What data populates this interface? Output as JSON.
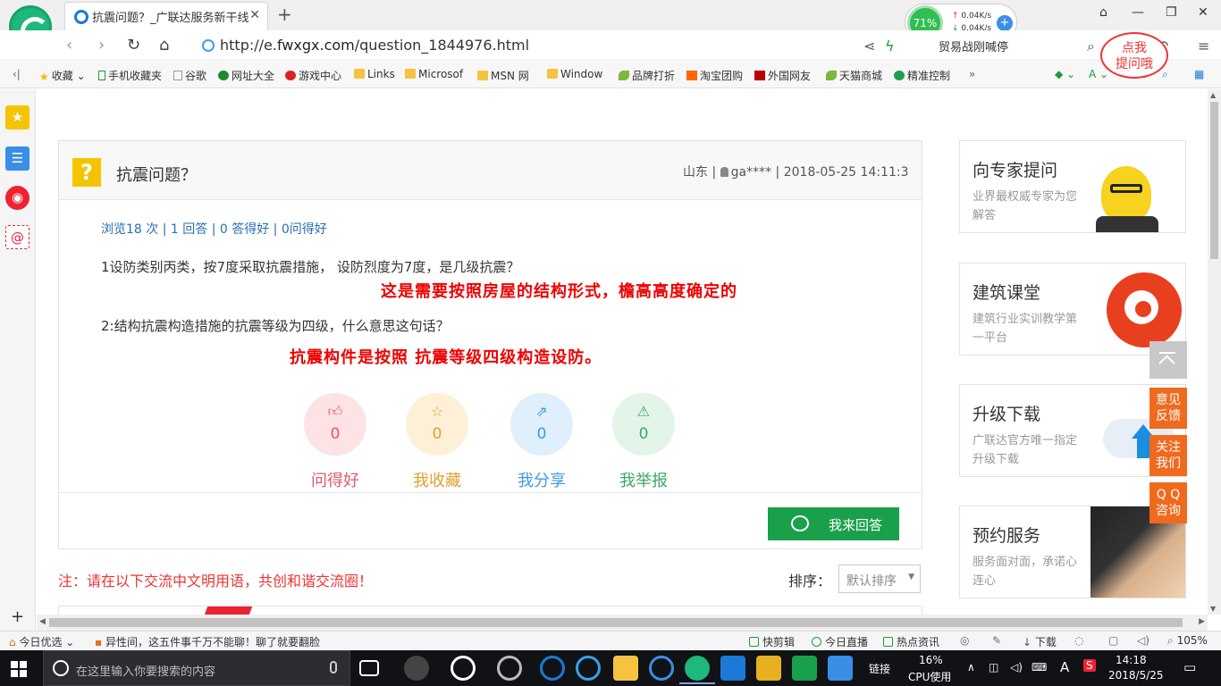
{
  "browser": {
    "tab_title": "抗震问题？_广联达服务新干线",
    "url_prefix": "http://e.",
    "url_domain": "fwxgx.com",
    "url_path": "/question_1844976.html",
    "search_hint": "贸易战刚喊停",
    "speed": {
      "percent": "71%",
      "up": "0.04K/s",
      "down": "0.04K/s"
    }
  },
  "bookmarks": [
    "收藏",
    "手机收藏夹",
    "谷歌",
    "网址大全",
    "游戏中心",
    "Links",
    "Microsof",
    "MSN 网",
    "Window",
    "品牌打折",
    "淘宝团购",
    "外国网友",
    "天猫商城",
    "精准控制"
  ],
  "question": {
    "title": "抗震问题？",
    "meta_location": "山东",
    "meta_user": "ga****",
    "meta_time": "2018-05-25 14:11:3",
    "stats": "浏览18 次 | 1 回答 | 0 答得好 | 0问得好",
    "line1": "1设防类别丙类，按7度采取抗震措施，  设防烈度为7度，是几级抗震？",
    "answer1": "这是需要按照房屋的结构形式，檐高高度确定的",
    "line2": "2:结构抗震构造措施的抗震等级为四级，什么意思这句话？",
    "answer2": "抗震构件是按照 抗震等级四级构造设防。",
    "actions": [
      {
        "label": "问得好",
        "count": "0",
        "color": "#e0586f",
        "bg": "#fde3e6",
        "icon": "thumb-up-icon"
      },
      {
        "label": "我收藏",
        "count": "0",
        "color": "#e0a030",
        "bg": "#fdf0d6",
        "icon": "star-icon"
      },
      {
        "label": "我分享",
        "count": "0",
        "color": "#3a9be0",
        "bg": "#dff0fc",
        "icon": "share-icon"
      },
      {
        "label": "我举报",
        "count": "0",
        "color": "#3aa868",
        "bg": "#e2f5e8",
        "icon": "warning-icon"
      }
    ],
    "answer_button": "我来回答"
  },
  "comments": {
    "notice": "注：请在以下交流中文明用语，共创和谐交流圈！",
    "sort_label": "排序：",
    "sort_value": "默认排序"
  },
  "sidebar": {
    "expert": {
      "title": "向专家提问",
      "desc": "业界最权威专家为您解答",
      "bubble": [
        "点我",
        "提问哦"
      ]
    },
    "course": {
      "title": "建筑课堂",
      "desc": "建筑行业实训教学第一平台"
    },
    "download": {
      "title": "升级下载",
      "desc": "广联达官方唯一指定升级下载"
    },
    "service": {
      "title": "预约服务",
      "desc": "服务面对面，承诺心连心"
    }
  },
  "floating": [
    [
      "意见",
      "反馈"
    ],
    [
      "关注",
      "我们"
    ],
    [
      "Q Q",
      "咨询"
    ]
  ],
  "statusbar": {
    "today": "今日优选",
    "headline": "异性间，这五件事千万不能聊！聊了就要翻脸",
    "items": [
      "快剪辑",
      "今日直播",
      "热点资讯",
      "下载"
    ],
    "zoom": "105%"
  },
  "taskbar": {
    "search_placeholder": "在这里输入你要搜索的内容",
    "link": "链接",
    "cpu_pct": "16%",
    "cpu_label": "CPU使用",
    "time": "14:18",
    "date": "2018/5/25",
    "ime": "A"
  }
}
